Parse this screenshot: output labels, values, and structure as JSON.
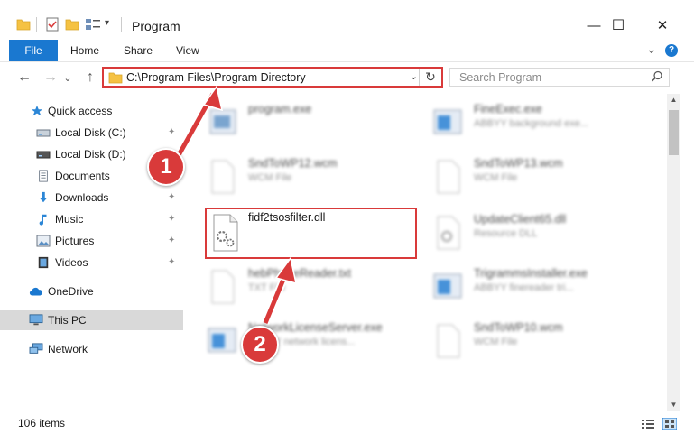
{
  "window": {
    "title": "Program",
    "minimize_glyph": "—",
    "maximize_glyph": "☐",
    "close_glyph": "✕",
    "qa_dropdown_glyph": "▾"
  },
  "ribbon": {
    "tabs": [
      "File",
      "Home",
      "Share",
      "View"
    ],
    "collapse_glyph": "⌄",
    "help_glyph": "?"
  },
  "nav": {
    "back_glyph": "←",
    "forward_glyph": "→",
    "recent_glyph": "⌄",
    "up_glyph": "↑"
  },
  "address": {
    "path": "C:\\Program Files\\Program Directory",
    "dropdown_glyph": "⌄",
    "refresh_glyph": "↻"
  },
  "search": {
    "placeholder": "Search Program"
  },
  "sidebar": {
    "items": [
      {
        "label": "Quick access",
        "icon": "star-icon",
        "pinned": false
      },
      {
        "label": "Local Disk (C:)",
        "icon": "drive-icon",
        "pinned": true
      },
      {
        "label": "Local Disk (D:)",
        "icon": "drive-icon",
        "pinned": true
      },
      {
        "label": "Documents",
        "icon": "documents-icon",
        "pinned": true
      },
      {
        "label": "Downloads",
        "icon": "download-icon",
        "pinned": true
      },
      {
        "label": "Music",
        "icon": "music-icon",
        "pinned": true
      },
      {
        "label": "Pictures",
        "icon": "pictures-icon",
        "pinned": true
      },
      {
        "label": "Videos",
        "icon": "videos-icon",
        "pinned": true
      },
      {
        "label": "OneDrive",
        "icon": "cloud-icon",
        "pinned": false
      },
      {
        "label": "This PC",
        "icon": "computer-icon",
        "pinned": false,
        "selected": true
      },
      {
        "label": "Network",
        "icon": "network-icon",
        "pinned": false
      }
    ],
    "pin_glyph": "📌"
  },
  "files": {
    "left": [
      {
        "name": "program.exe",
        "type": ""
      },
      {
        "name": "SndToWP12.wcm",
        "type": "WCM File"
      },
      {
        "name": "fidf2tsosfilter.dll",
        "type": ""
      },
      {
        "name": "hebPhoneReader.txt",
        "type": "TXT File"
      },
      {
        "name": "NetworkLicenseServer.exe",
        "type": "ABBYY network licens..."
      }
    ],
    "right": [
      {
        "name": "FineExec.exe",
        "type": "ABBYY background exe..."
      },
      {
        "name": "SndToWP13.wcm",
        "type": "WCM File"
      },
      {
        "name": "UpdateClient65.dll",
        "type": "Resource DLL"
      },
      {
        "name": "TrigrammsInstaller.exe",
        "type": "ABBYY finereader tri..."
      },
      {
        "name": "SndToWP10.wcm",
        "type": "WCM File"
      }
    ]
  },
  "scroll": {
    "up_glyph": "▲",
    "down_glyph": "▼"
  },
  "status": {
    "item_count": "106 items"
  },
  "callouts": [
    "1",
    "2"
  ],
  "colors": {
    "accent": "#1a78d0",
    "highlight": "#d93a3a",
    "selected_bg": "#d9d9d9"
  }
}
